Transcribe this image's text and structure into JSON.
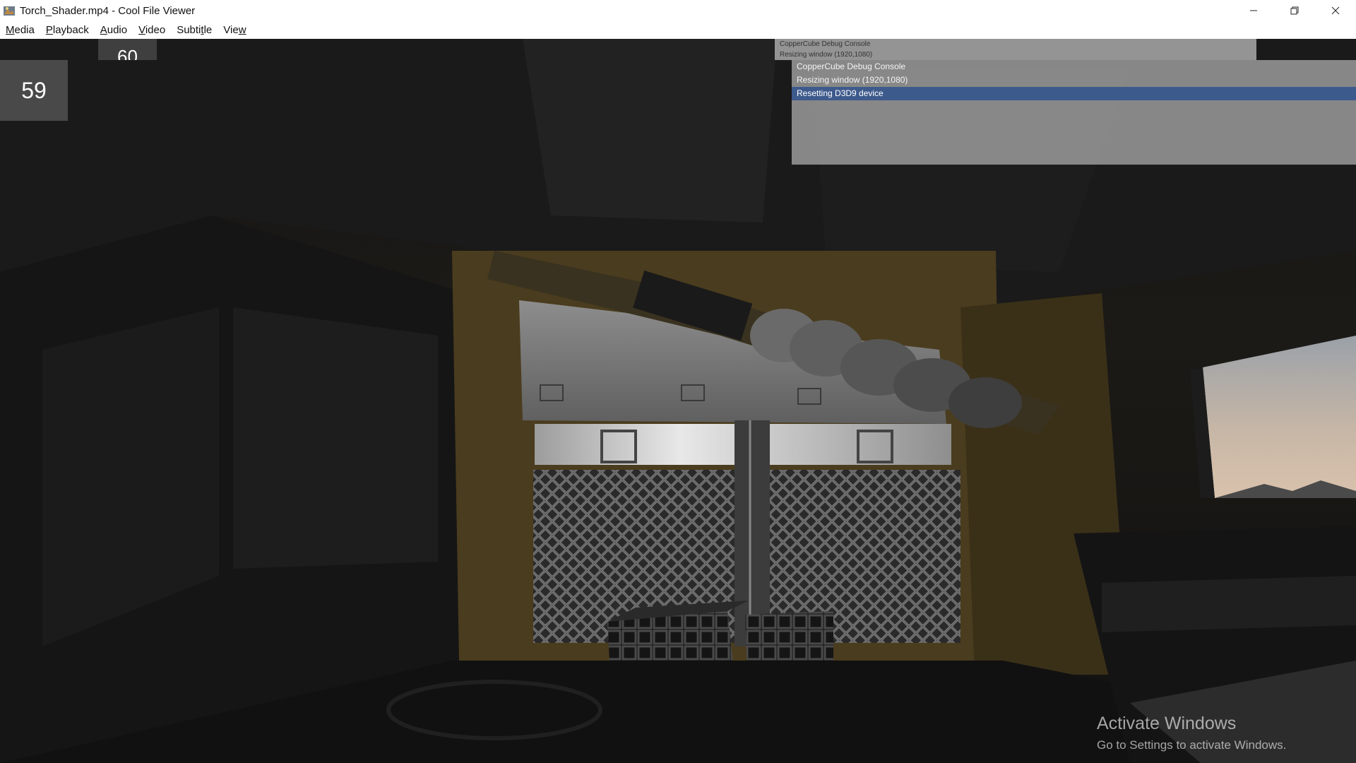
{
  "window": {
    "title": "Torch_Shader.mp4 - Cool File Viewer",
    "controls": {
      "minimize": "—",
      "restore": "❐",
      "close": "✕"
    }
  },
  "menu": {
    "media": {
      "key": "M",
      "rest": "edia"
    },
    "playback": {
      "key": "P",
      "rest": "layback"
    },
    "audio": {
      "key": "A",
      "rest": "udio"
    },
    "video": {
      "key": "V",
      "rest": "ideo"
    },
    "subtitle": {
      "pre": "Subti",
      "key": "t",
      "post": "le"
    },
    "view": {
      "pre": "Vie",
      "key": "w"
    }
  },
  "overlay": {
    "fps": "59",
    "fps_ghost": "60",
    "console_back_lines": [
      "CopperCube Debug Console",
      "Resizing window (1920,1080)"
    ],
    "console_lines": [
      "CopperCube Debug Console",
      "Resizing window (1920,1080)",
      "Resetting D3D9 device"
    ],
    "selected_line_index": 2,
    "selected_color": "#3d5a8c"
  },
  "watermark": {
    "title": "Activate Windows",
    "subtitle": "Go to Settings to activate Windows."
  }
}
